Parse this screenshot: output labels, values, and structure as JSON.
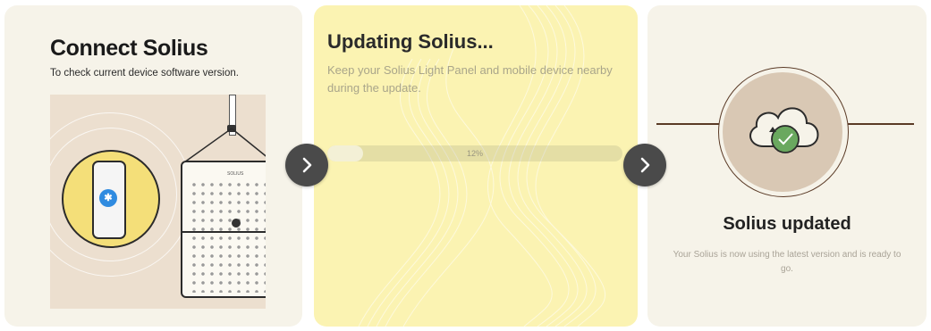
{
  "steps": [
    {
      "title": "Connect Solius",
      "subtitle": "To check current device software version.",
      "panel_logo": "SOLIUS"
    },
    {
      "title": "Updating Solius...",
      "subtitle": "Keep your Solius Light Panel and mobile device nearby during the update.",
      "progress": {
        "value": 0.12,
        "label": "12%"
      }
    },
    {
      "title": "Solius updated",
      "subtitle": "Your Solius is now using the latest version and is ready to go."
    }
  ],
  "navigation": {
    "next_icon": "chevron-right-icon"
  },
  "colors": {
    "card_bg": "#f6f3e9",
    "updating_bg": "#fbf3b2",
    "accent_yellow": "#f4df79",
    "bluetooth_blue": "#2f8be0",
    "success_green": "#6aa85f",
    "arrow_bg": "#4a4a4a",
    "outline_brown": "#5a3a26"
  }
}
